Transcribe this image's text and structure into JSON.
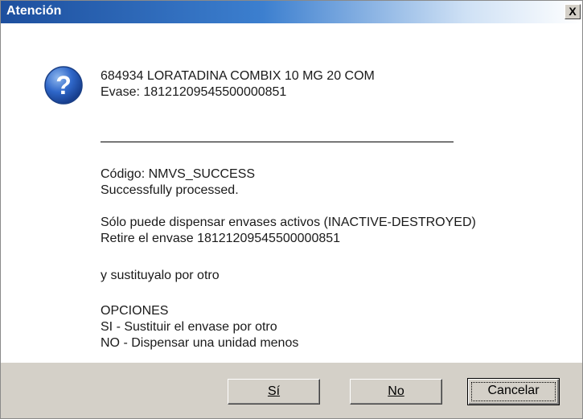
{
  "dialog": {
    "title": "Atención",
    "close_label": "X",
    "icon": "question-icon",
    "colors": {
      "titlebar_start": "#1d4f9e",
      "footer": "#d4d0c8"
    },
    "message": {
      "line1": "684934 LORATADINA COMBIX 10 MG 20 COM",
      "line2": "Evase: 18121209545500000851",
      "code_line": "Código: NMVS_SUCCESS",
      "status_line": "Successfully processed.",
      "warning_line": "Sólo puede dispensar envases activos (INACTIVE-DESTROYED)",
      "retire_line": "Retire el envase 18121209545500000851",
      "replace_line": "y sustituyalo por otro",
      "options_header": "OPCIONES",
      "option_si": "SI - Sustituir el envase por otro",
      "option_no": "NO - Dispensar una unidad menos"
    },
    "buttons": {
      "yes_label": "Sí",
      "no_label": "No",
      "cancel_label": "Cancelar"
    }
  }
}
